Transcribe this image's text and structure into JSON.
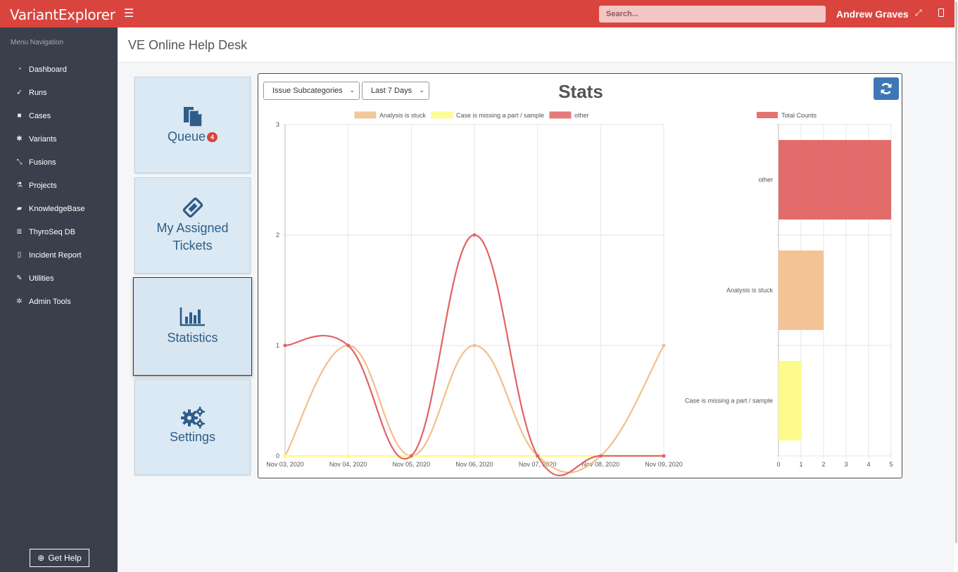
{
  "app": {
    "logo": "VariantExplorer",
    "user": "Andrew Graves",
    "search_placeholder": "Search..."
  },
  "sidebar": {
    "title": "Menu Navigation",
    "items": [
      {
        "label": "Dashboard",
        "icon": "gauge-icon",
        "glyph": "◔"
      },
      {
        "label": "Runs",
        "icon": "rocket-icon",
        "glyph": "➶"
      },
      {
        "label": "Cases",
        "icon": "folder-icon",
        "glyph": "■"
      },
      {
        "label": "Variants",
        "icon": "asterisk-icon",
        "glyph": "✱"
      },
      {
        "label": "Fusions",
        "icon": "compress-icon",
        "glyph": "⤡"
      },
      {
        "label": "Projects",
        "icon": "flask-icon",
        "glyph": "⚗"
      },
      {
        "label": "KnowledgeBase",
        "icon": "book-icon",
        "glyph": "▰"
      },
      {
        "label": "ThyroSeq DB",
        "icon": "database-icon",
        "glyph": "≣"
      },
      {
        "label": "Incident Report",
        "icon": "file-icon",
        "glyph": "▯"
      },
      {
        "label": "Utilities",
        "icon": "wrench-icon",
        "glyph": "✎"
      },
      {
        "label": "Admin Tools",
        "icon": "cog-icon",
        "glyph": "✲"
      }
    ],
    "help_label": "Get Help"
  },
  "page": {
    "title": "VE Online Help Desk"
  },
  "cards": {
    "queue": {
      "label": "Queue",
      "badge": "4"
    },
    "assigned_line1": "My Assigned",
    "assigned_line2": "Tickets",
    "statistics": "Statistics",
    "settings": "Settings"
  },
  "stats": {
    "title": "Stats",
    "category_select": "Issue Subcategories",
    "range_select": "Last 7 Days",
    "accent": "#3e77b6"
  },
  "chart_data": [
    {
      "type": "line",
      "x": [
        "Nov 03, 2020",
        "Nov 04, 2020",
        "Nov 05, 2020",
        "Nov 06, 2020",
        "Nov 07, 2020",
        "Nov 08, 2020",
        "Nov 09, 2020"
      ],
      "ylim": [
        0,
        3
      ],
      "yticks": [
        0,
        1,
        2,
        3
      ],
      "grid": true,
      "legend": "top",
      "series": [
        {
          "name": "Analysis is stuck",
          "values": [
            0,
            1,
            0,
            1,
            0,
            0,
            1
          ],
          "color": "#f1bf8c"
        },
        {
          "name": "Case is missing a part / sample",
          "values": [
            0,
            0,
            0,
            0,
            0,
            0,
            0
          ],
          "color": "#fdfb86"
        },
        {
          "name": "other",
          "values": [
            1,
            1,
            0,
            2,
            0,
            0,
            0
          ],
          "color": "#e06463"
        }
      ]
    },
    {
      "type": "bar",
      "orientation": "horizontal",
      "legend": "top",
      "series_name": "Total Counts",
      "categories": [
        "other",
        "Analysis is stuck",
        "Case is missing a part / sample"
      ],
      "values": [
        5,
        2,
        1
      ],
      "colors": [
        "#e06463",
        "#f3c08f",
        "#fdfb86"
      ],
      "xlim": [
        0,
        5
      ],
      "xticks": [
        0,
        1,
        2,
        3,
        4,
        5
      ],
      "grid": true
    }
  ]
}
